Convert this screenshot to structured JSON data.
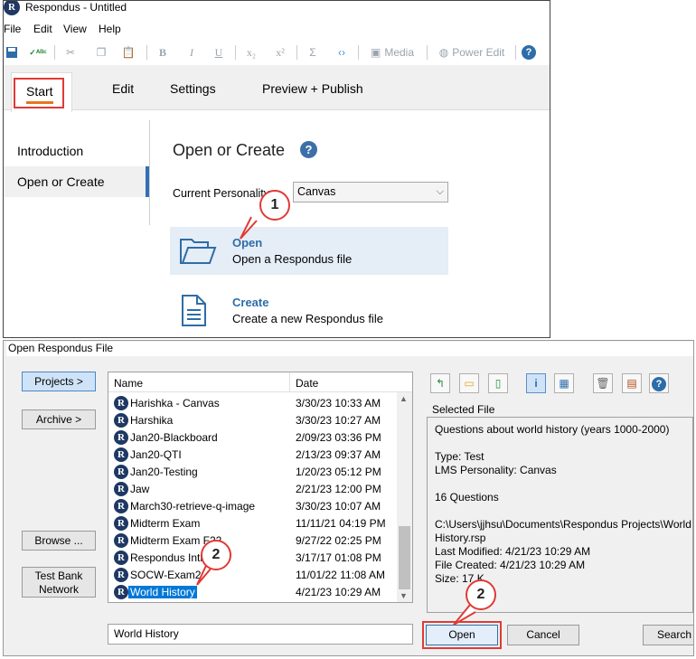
{
  "window": {
    "title": "Respondus - Untitled"
  },
  "menu": [
    "File",
    "Edit",
    "View",
    "Help"
  ],
  "toolbar": {
    "media": "Media",
    "power_edit": "Power Edit"
  },
  "tabs": [
    "Start",
    "Edit",
    "Settings",
    "Preview + Publish"
  ],
  "nav": [
    "Introduction",
    "Open or Create"
  ],
  "main": {
    "title": "Open or Create",
    "personality_label": "Current Personality:",
    "personality_value": "Canvas",
    "open_title": "Open",
    "open_desc": "Open a Respondus file",
    "create_title": "Create",
    "create_desc": "Create a new Respondus file"
  },
  "callouts": [
    "1",
    "2",
    "2"
  ],
  "dialog": {
    "title": "Open Respondus File",
    "buttons": {
      "projects": "Projects >",
      "archive": "Archive >",
      "browse": "Browse ...",
      "test_bank_1": "Test Bank",
      "test_bank_2": "Network"
    },
    "columns": {
      "name": "Name",
      "date": "Date"
    },
    "files": [
      {
        "name": "Harishka - Canvas",
        "date": "3/30/23  10:33 AM"
      },
      {
        "name": "Harshika",
        "date": "3/30/23  10:27 AM"
      },
      {
        "name": "Jan20-Blackboard",
        "date": "2/09/23  03:36 PM"
      },
      {
        "name": "Jan20-QTI",
        "date": "2/13/23  09:37 AM"
      },
      {
        "name": "Jan20-Testing",
        "date": "1/20/23  05:12 PM"
      },
      {
        "name": "Jaw",
        "date": "2/21/23  12:00 PM"
      },
      {
        "name": "March30-retrieve-q-image",
        "date": "3/30/23  10:07 AM"
      },
      {
        "name": "Midterm Exam",
        "date": "11/11/21  04:19 PM"
      },
      {
        "name": "Midterm Exam F22",
        "date": "9/27/22  02:25 PM"
      },
      {
        "name": "Respondus Intro...",
        "date": "3/17/17  01:08 PM"
      },
      {
        "name": "SOCW-Exam2",
        "date": "11/01/22  11:08 AM"
      },
      {
        "name": "World History",
        "date": "4/21/23  10:29 AM"
      }
    ],
    "filename_input": "World History",
    "selected_file_label": "Selected File",
    "selected_file_lines": [
      "Questions about world history (years 1000-2000)",
      "",
      "Type: Test",
      "LMS Personality: Canvas",
      "",
      "16 Questions",
      "",
      "C:\\Users\\jjhsu\\Documents\\Respondus Projects\\World",
      "History.rsp",
      "Last Modified: 4/21/23  10:29 AM",
      "File Created: 4/21/23  10:29 AM",
      "Size: 17 K"
    ],
    "open_label": "Open",
    "cancel_label": "Cancel",
    "search_label": "Search"
  },
  "colors": {
    "accent": "#2d6da8",
    "highlight": "#e03a36",
    "tab_underline": "#e8751a",
    "selection": "#0078d7"
  }
}
